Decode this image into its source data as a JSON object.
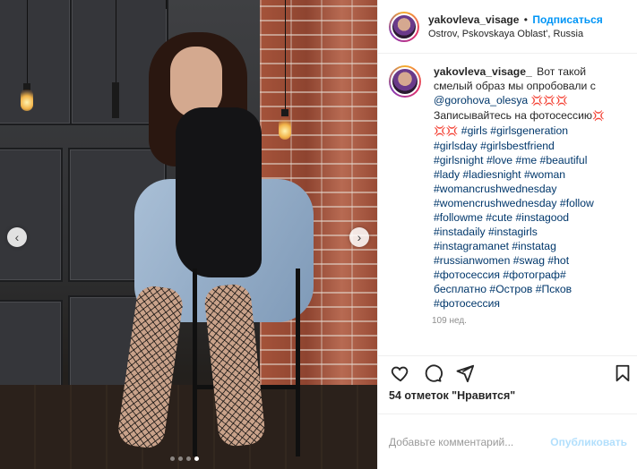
{
  "post": {
    "username": "yakovleva_visage",
    "separator": "•",
    "follow_label": "Подписаться",
    "location": "Ostrov, Pskovskaya Oblast', Russia"
  },
  "caption": {
    "username": "yakovleva_visage_",
    "text_lines": [
      "Вот такой",
      "смелый образ мы опробовали с",
      "@gorohova_olesya",
      "Записывайтесь на фотосессию",
      "#girls #girlsgeneration",
      "#girlsday #girlsbestfriend",
      "#girlsnight #love #me #beautiful",
      "#lady #ladiesnight #woman",
      "#womancrushwednesday",
      "#womencrushwednesday #follow",
      "#followme #cute #instagood",
      "#instadaily #instagirls",
      "#instagramanet #instatag",
      "#russianwomen #swag #hot",
      "#фотосессия #фотограф#",
      "бесплатно #Остров #Псков",
      "#фотосессия"
    ],
    "emoji": "💢💢💢",
    "emoji2": "💢",
    "emoji3": "💢💢",
    "time": "109 нед."
  },
  "likes_text": "54 отметок \"Нравится\"",
  "comment_input": {
    "placeholder": "Добавьте комментарий...",
    "publish_label": "Опубликовать"
  },
  "icons": {
    "like": "heart-icon",
    "comment": "comment-icon",
    "share": "share-icon",
    "save": "bookmark-icon",
    "prev": "chevron-left-icon",
    "next": "chevron-right-icon"
  },
  "carousel": {
    "count": 4,
    "active_index": 3
  },
  "colors": {
    "accent": "#0095f6",
    "hashtag": "#00376b",
    "muted": "#8e8e8e"
  }
}
